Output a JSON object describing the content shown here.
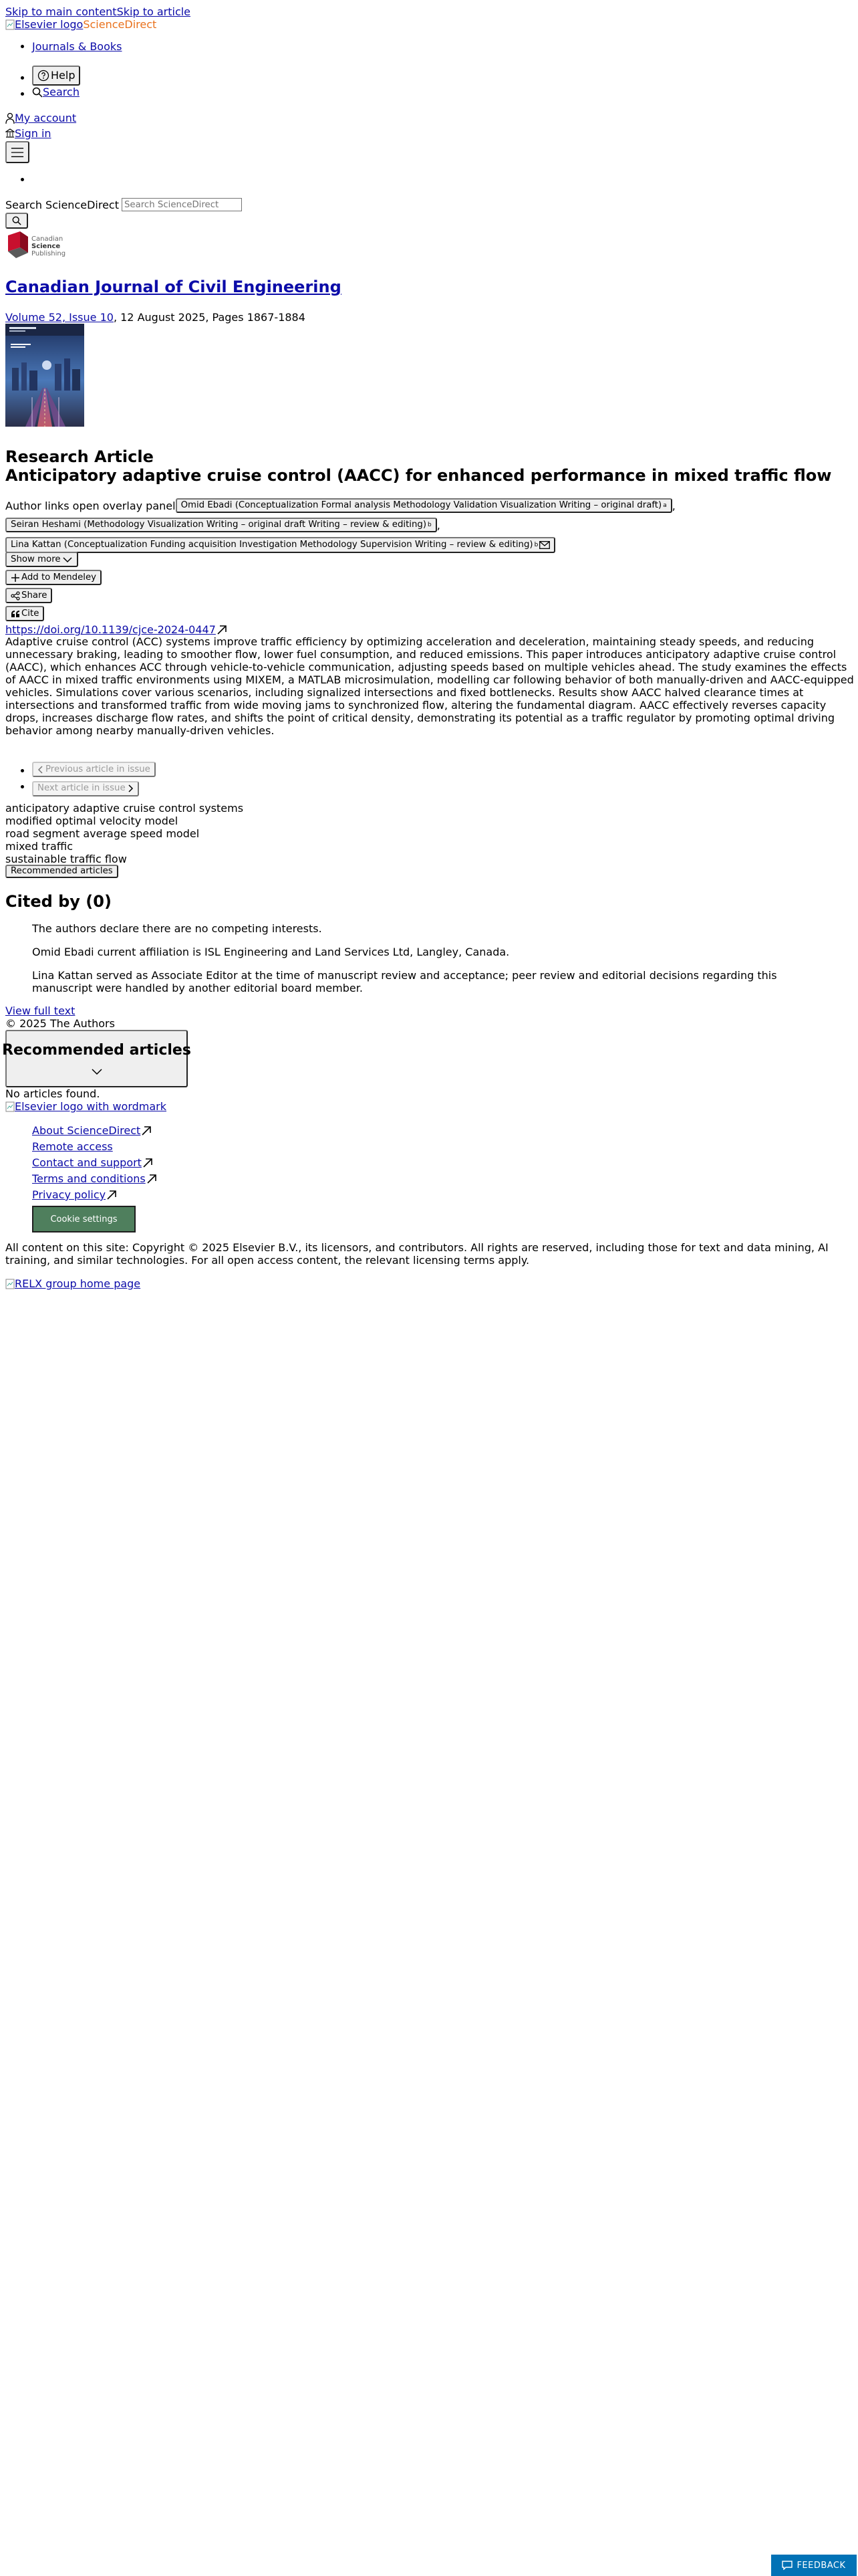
{
  "skip_links": {
    "main": "Skip to main content",
    "article": "Skip to article"
  },
  "header": {
    "logo_alt": "Elsevier logo",
    "brand": "ScienceDirect",
    "nav": {
      "journals_books": "Journals & Books",
      "help": "Help",
      "search": "Search"
    },
    "my_account": "My account",
    "sign_in": "Sign in"
  },
  "search": {
    "label": "Search ScienceDirect",
    "placeholder": "Search ScienceDirect"
  },
  "publisher_logo": {
    "line1": "Canadian",
    "line2": "Science",
    "line3": "Publishing"
  },
  "journal": {
    "title": "Canadian Journal of Civil Engineering",
    "volume_issue": "Volume 52, Issue 10",
    "date_pages": ", 12 August 2025, Pages 1867-1884"
  },
  "article": {
    "type": "Research Article",
    "title": "Anticipatory adaptive cruise control (AACC) for enhanced performance in mixed traffic flow",
    "author_links_label": "Author links open overlay panel",
    "authors": [
      {
        "name": "Omid Ebadi (Conceptualization Formal analysis Methodology Validation Visualization Writing – original draft)",
        "sup": "a",
        "sep": ","
      },
      {
        "name": "Seiran Heshami (Methodology Visualization Writing – original draft Writing – review & editing)",
        "sup": "b",
        "sep": ","
      },
      {
        "name": "Lina Kattan (Conceptualization Funding acquisition Investigation Methodology Supervision Writing – review & editing)",
        "sup": "b",
        "sep": ""
      }
    ],
    "show_more": "Show more",
    "add_to_mendeley": "Add to Mendeley",
    "share": "Share",
    "cite": "Cite",
    "doi": "https://doi.org/10.1139/cjce-2024-0447",
    "abstract": "Adaptive cruise control (ACC) systems improve traffic efficiency by optimizing acceleration and deceleration, maintaining steady speeds, and reducing unnecessary braking, leading to smoother flow, lower fuel consumption, and reduced emissions. This paper introduces anticipatory adaptive cruise control (AACC), which enhances ACC through vehicle-to-vehicle communication, adjusting speeds based on multiple vehicles ahead. The study examines the effects of AACC in mixed traffic environments using MIXEM, a MATLAB microsimulation, modelling car following behavior of both manually-driven and AACC-equipped vehicles. Simulations cover various scenarios, including signalized intersections and fixed bottlenecks. Results show AACC halved clearance times at intersections and transformed traffic from wide moving jams to synchronized flow, altering the fundamental diagram. AACC effectively reverses capacity drops, increases discharge flow rates, and shifts the point of critical density, demonstrating its potential as a traffic regulator by promoting optimal driving behavior among nearby manually-driven vehicles.",
    "prev_article": "Previous article in issue",
    "next_article": "Next article in issue",
    "keywords": [
      "anticipatory adaptive cruise control systems",
      "modified optimal velocity model",
      "road segment average speed model",
      "mixed traffic",
      "sustainable traffic flow"
    ],
    "recommended_articles_btn": "Recommended articles",
    "cited_by": "Cited by (0)",
    "footnotes": [
      "The authors declare there are no competing interests.",
      "Omid Ebadi current affiliation is ISL Engineering and Land Services Ltd, Langley, Canada.",
      "Lina Kattan served as Associate Editor at the time of manuscript review and acceptance; peer review and editorial decisions regarding this manuscript were handled by another editorial board member."
    ],
    "view_full_text": "View full text",
    "copyright": "© 2025 The Authors"
  },
  "recommended": {
    "heading": "Recommended articles",
    "empty": "No articles found."
  },
  "footer": {
    "logo_alt": "Elsevier logo with wordmark",
    "links": [
      "About ScienceDirect",
      "Remote access",
      "Contact and support",
      "Terms and conditions",
      "Privacy policy"
    ],
    "cookie_settings": "Cookie settings",
    "notice": "All content on this site: Copyright © 2025 Elsevier B.V., its licensors, and contributors. All rights are reserved, including those for text and data mining, AI training, and similar technologies. For all open access content, the relevant licensing terms apply.",
    "relx_alt": "RELX group home page"
  },
  "feedback": {
    "label": "FEEDBACK"
  },
  "colors": {
    "link": "#0c0ca8",
    "brand_orange": "#e9711c",
    "cookie_button": "#4f7f5d",
    "feedback_button": "#0272b6",
    "csp_red": "#c8102e"
  }
}
